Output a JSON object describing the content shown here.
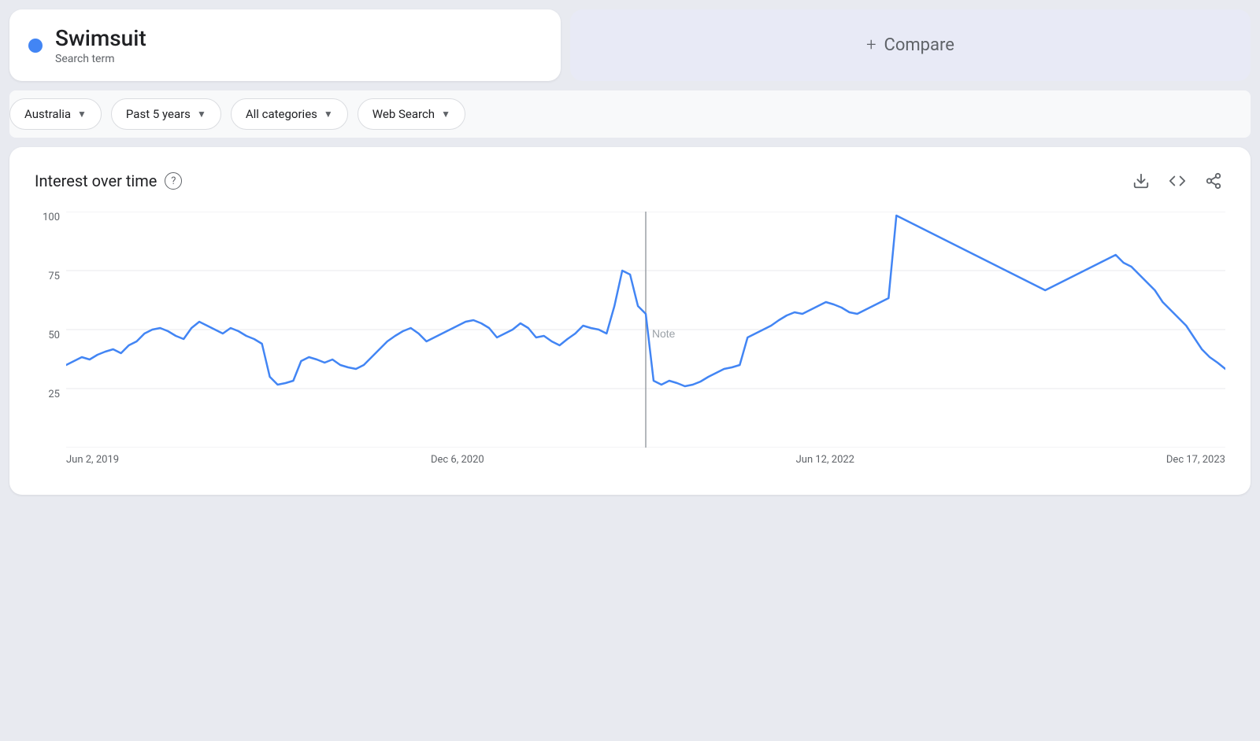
{
  "search": {
    "term": "Swimsuit",
    "label": "Search term",
    "dot_color": "#4285f4"
  },
  "compare": {
    "label": "Compare",
    "plus": "+"
  },
  "filters": [
    {
      "id": "region",
      "label": "Australia"
    },
    {
      "id": "timerange",
      "label": "Past 5 years"
    },
    {
      "id": "category",
      "label": "All categories"
    },
    {
      "id": "searchtype",
      "label": "Web Search"
    }
  ],
  "chart": {
    "title": "Interest over time",
    "help_label": "?",
    "y_labels": [
      "100",
      "75",
      "50",
      "25"
    ],
    "x_labels": [
      "Jun 2, 2019",
      "Dec 6, 2020",
      "Jun 12, 2022",
      "Dec 17, 2023"
    ],
    "note_text": "Note",
    "actions": [
      {
        "id": "download",
        "symbol": "⬇"
      },
      {
        "id": "embed",
        "symbol": "<>"
      },
      {
        "id": "share",
        "symbol": "↗"
      }
    ]
  }
}
